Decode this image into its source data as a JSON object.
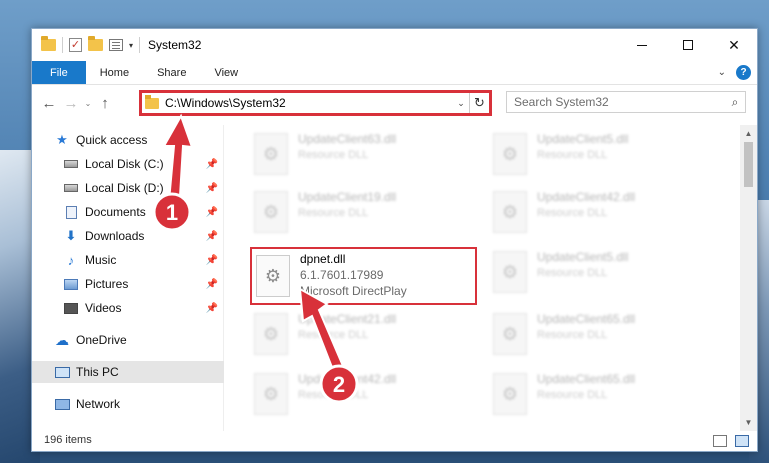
{
  "window": {
    "title": "System32",
    "minimize_glyph": "—",
    "maximize_glyph": "☐",
    "close_glyph": "✕"
  },
  "ribbon": {
    "tabs": [
      "File",
      "Home",
      "Share",
      "View"
    ],
    "help_label": "?"
  },
  "address": {
    "path": "C:\\Windows\\System32",
    "search_placeholder": "Search System32"
  },
  "sidebar": {
    "items": [
      {
        "label": "Quick access",
        "icon": "star-icon",
        "pinned": false
      },
      {
        "label": "Local Disk (C:)",
        "icon": "drive-icon",
        "pinned": true
      },
      {
        "label": "Local Disk (D:)",
        "icon": "drive-icon",
        "pinned": true
      },
      {
        "label": "Documents",
        "icon": "documents-icon",
        "pinned": true
      },
      {
        "label": "Downloads",
        "icon": "download-icon",
        "pinned": true
      },
      {
        "label": "Music",
        "icon": "music-icon",
        "pinned": true
      },
      {
        "label": "Pictures",
        "icon": "pictures-icon",
        "pinned": true
      },
      {
        "label": "Videos",
        "icon": "videos-icon",
        "pinned": true
      },
      {
        "label": "OneDrive",
        "icon": "cloud-icon",
        "pinned": false
      },
      {
        "label": "This PC",
        "icon": "computer-icon",
        "pinned": false,
        "selected": true
      },
      {
        "label": "Network",
        "icon": "network-icon",
        "pinned": false
      }
    ]
  },
  "files": [
    {
      "name": "UpdateClient63.dll",
      "type": "Resource DLL"
    },
    {
      "name": "UpdateClient5.dll",
      "type": "Resource DLL"
    },
    {
      "name": "UpdateClient19.dll",
      "type": "Resource DLL"
    },
    {
      "name": "UpdateClient42.dll",
      "type": "Resource DLL"
    },
    {
      "name": "dpnet.dll",
      "version": "6.1.7601.17989",
      "description": "Microsoft DirectPlay"
    },
    {
      "name": "UpdateClient5.dll",
      "type": "Resource DLL"
    },
    {
      "name": "UpdateClient21.dll",
      "type": "Resource DLL"
    },
    {
      "name": "UpdateClient65.dll",
      "type": "Resource DLL"
    },
    {
      "name": "UpdateClient42.dll",
      "type": "Resource DLL"
    },
    {
      "name": "UpdateClient65.dll",
      "type": "Resource DLL"
    }
  ],
  "status": {
    "item_count": "196 items"
  },
  "callouts": [
    "1",
    "2"
  ],
  "colors": {
    "accent": "#1979ca",
    "highlight_red": "#d8313a"
  }
}
